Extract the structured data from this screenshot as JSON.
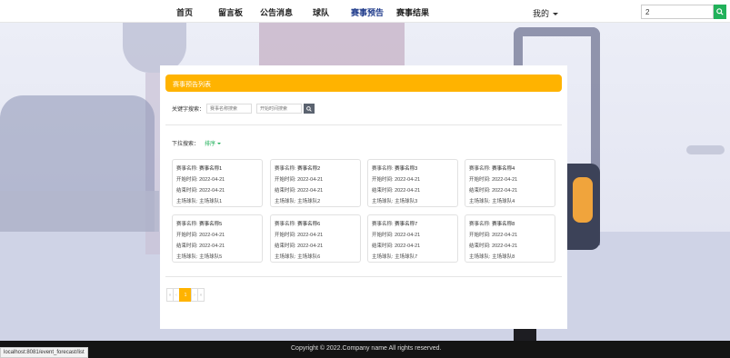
{
  "nav": {
    "items": [
      {
        "label": "首页"
      },
      {
        "label": "留言板"
      },
      {
        "label": "公告消息"
      },
      {
        "label": "球队"
      },
      {
        "label": "赛事预告"
      },
      {
        "label": "赛事结果"
      }
    ],
    "user_label": "我的",
    "search_value": "2",
    "accent": "#21b15a"
  },
  "panel": {
    "title": "赛事预告列表",
    "keyword_label": "关键字搜索：",
    "keyword_placeholder": "赛事名称搜索",
    "date_placeholder": "开始时间搜索",
    "dropdown_label": "下拉搜索：",
    "sort_label": "排序",
    "header_color": "#ffb300"
  },
  "cards": [
    {
      "name_key": "赛事名称:",
      "name": "赛事名称1",
      "start_key": "开始时间:",
      "start": "2022-04-21",
      "end_key": "结束时间:",
      "end": "2022-04-21",
      "team_key": "主场球队:",
      "team": "主场球队1"
    },
    {
      "name_key": "赛事名称:",
      "name": "赛事名称2",
      "start_key": "开始时间:",
      "start": "2022-04-21",
      "end_key": "结束时间:",
      "end": "2022-04-21",
      "team_key": "主场球队:",
      "team": "主场球队2"
    },
    {
      "name_key": "赛事名称:",
      "name": "赛事名称3",
      "start_key": "开始时间:",
      "start": "2022-04-21",
      "end_key": "结束时间:",
      "end": "2022-04-21",
      "team_key": "主场球队:",
      "team": "主场球队3"
    },
    {
      "name_key": "赛事名称:",
      "name": "赛事名称4",
      "start_key": "开始时间:",
      "start": "2022-04-21",
      "end_key": "结束时间:",
      "end": "2022-04-21",
      "team_key": "主场球队:",
      "team": "主场球队4"
    },
    {
      "name_key": "赛事名称:",
      "name": "赛事名称5",
      "start_key": "开始时间:",
      "start": "2022-04-21",
      "end_key": "结束时间:",
      "end": "2022-04-21",
      "team_key": "主场球队:",
      "team": "主场球队5"
    },
    {
      "name_key": "赛事名称:",
      "name": "赛事名称6",
      "start_key": "开始时间:",
      "start": "2022-04-21",
      "end_key": "结束时间:",
      "end": "2022-04-21",
      "team_key": "主场球队:",
      "team": "主场球队6"
    },
    {
      "name_key": "赛事名称:",
      "name": "赛事名称7",
      "start_key": "开始时间:",
      "start": "2022-04-21",
      "end_key": "结束时间:",
      "end": "2022-04-21",
      "team_key": "主场球队:",
      "team": "主场球队7"
    },
    {
      "name_key": "赛事名称:",
      "name": "赛事名称8",
      "start_key": "开始时间:",
      "start": "2022-04-21",
      "end_key": "结束时间:",
      "end": "2022-04-21",
      "team_key": "主场球队:",
      "team": "主场球队8"
    }
  ],
  "pager": {
    "first": "«",
    "prev": "‹",
    "current": "1",
    "next": "›",
    "last": "»"
  },
  "footer": {
    "copyright": "Copyright © 2022.Company name All rights reserved."
  },
  "status_bar": {
    "url": "localhost:8081/event_forecast/list"
  }
}
